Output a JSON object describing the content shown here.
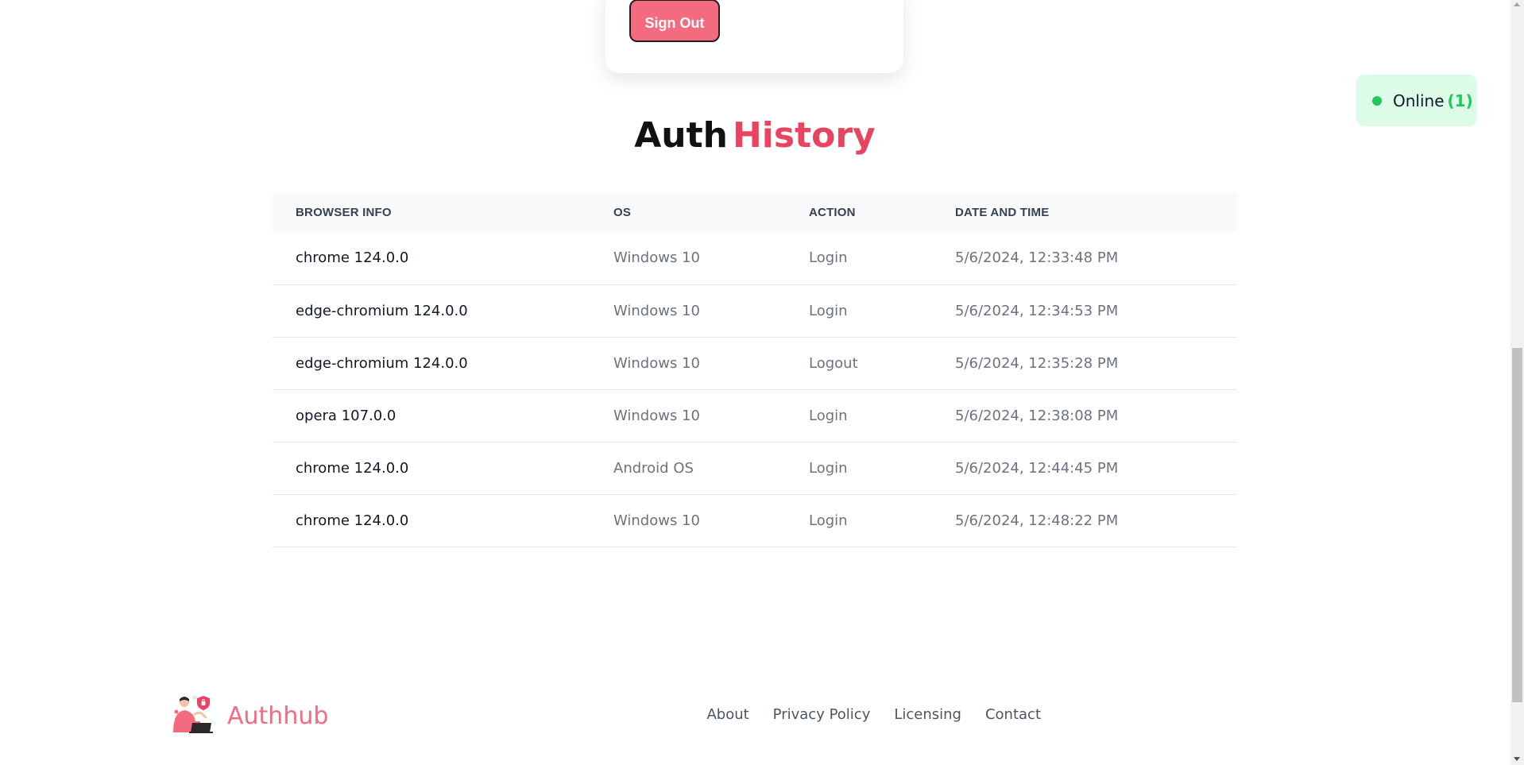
{
  "profile_card": {
    "signout_label": "Sign Out"
  },
  "online": {
    "label": "Online",
    "count": "(1)",
    "color": "#22c55e"
  },
  "heading": {
    "part1": "Auth",
    "part2": "History",
    "accent_color": "#e8435f"
  },
  "table": {
    "headers": [
      "BROWSER INFO",
      "OS",
      "ACTION",
      "DATE AND TIME"
    ],
    "rows": [
      {
        "browser": "chrome 124.0.0",
        "os": "Windows 10",
        "action": "Login",
        "datetime": "5/6/2024, 12:33:48 PM"
      },
      {
        "browser": "edge-chromium 124.0.0",
        "os": "Windows 10",
        "action": "Login",
        "datetime": "5/6/2024, 12:34:53 PM"
      },
      {
        "browser": "edge-chromium 124.0.0",
        "os": "Windows 10",
        "action": "Logout",
        "datetime": "5/6/2024, 12:35:28 PM"
      },
      {
        "browser": "opera 107.0.0",
        "os": "Windows 10",
        "action": "Login",
        "datetime": "5/6/2024, 12:38:08 PM"
      },
      {
        "browser": "chrome 124.0.0",
        "os": "Android OS",
        "action": "Login",
        "datetime": "5/6/2024, 12:44:45 PM"
      },
      {
        "browser": "chrome 124.0.0",
        "os": "Windows 10",
        "action": "Login",
        "datetime": "5/6/2024, 12:48:22 PM"
      }
    ]
  },
  "footer": {
    "brand": "Authhub",
    "brand_color": "#f46b7f",
    "logo_icon": "person-laptop-shield-icon",
    "links": [
      "About",
      "Privacy Policy",
      "Licensing",
      "Contact"
    ]
  }
}
